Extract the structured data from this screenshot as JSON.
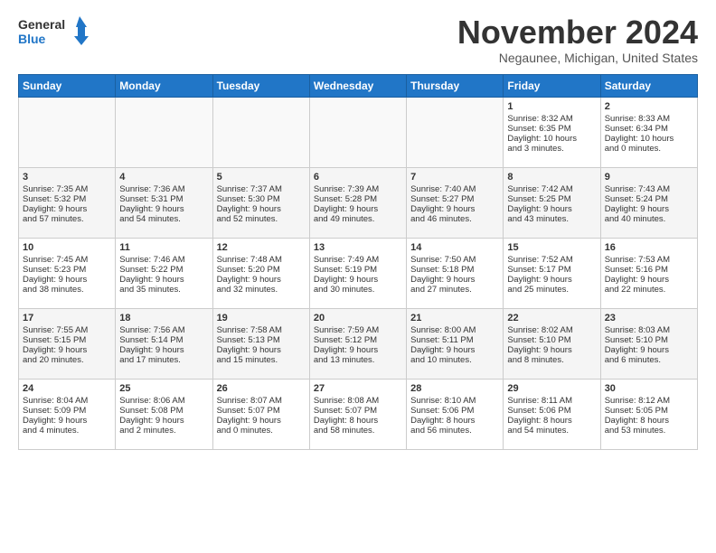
{
  "header": {
    "logo_line1": "General",
    "logo_line2": "Blue",
    "month_title": "November 2024",
    "location": "Negaunee, Michigan, United States"
  },
  "weekdays": [
    "Sunday",
    "Monday",
    "Tuesday",
    "Wednesday",
    "Thursday",
    "Friday",
    "Saturday"
  ],
  "weeks": [
    [
      {
        "day": "",
        "info": ""
      },
      {
        "day": "",
        "info": ""
      },
      {
        "day": "",
        "info": ""
      },
      {
        "day": "",
        "info": ""
      },
      {
        "day": "",
        "info": ""
      },
      {
        "day": "1",
        "info": "Sunrise: 8:32 AM\nSunset: 6:35 PM\nDaylight: 10 hours\nand 3 minutes."
      },
      {
        "day": "2",
        "info": "Sunrise: 8:33 AM\nSunset: 6:34 PM\nDaylight: 10 hours\nand 0 minutes."
      }
    ],
    [
      {
        "day": "3",
        "info": "Sunrise: 7:35 AM\nSunset: 5:32 PM\nDaylight: 9 hours\nand 57 minutes."
      },
      {
        "day": "4",
        "info": "Sunrise: 7:36 AM\nSunset: 5:31 PM\nDaylight: 9 hours\nand 54 minutes."
      },
      {
        "day": "5",
        "info": "Sunrise: 7:37 AM\nSunset: 5:30 PM\nDaylight: 9 hours\nand 52 minutes."
      },
      {
        "day": "6",
        "info": "Sunrise: 7:39 AM\nSunset: 5:28 PM\nDaylight: 9 hours\nand 49 minutes."
      },
      {
        "day": "7",
        "info": "Sunrise: 7:40 AM\nSunset: 5:27 PM\nDaylight: 9 hours\nand 46 minutes."
      },
      {
        "day": "8",
        "info": "Sunrise: 7:42 AM\nSunset: 5:25 PM\nDaylight: 9 hours\nand 43 minutes."
      },
      {
        "day": "9",
        "info": "Sunrise: 7:43 AM\nSunset: 5:24 PM\nDaylight: 9 hours\nand 40 minutes."
      }
    ],
    [
      {
        "day": "10",
        "info": "Sunrise: 7:45 AM\nSunset: 5:23 PM\nDaylight: 9 hours\nand 38 minutes."
      },
      {
        "day": "11",
        "info": "Sunrise: 7:46 AM\nSunset: 5:22 PM\nDaylight: 9 hours\nand 35 minutes."
      },
      {
        "day": "12",
        "info": "Sunrise: 7:48 AM\nSunset: 5:20 PM\nDaylight: 9 hours\nand 32 minutes."
      },
      {
        "day": "13",
        "info": "Sunrise: 7:49 AM\nSunset: 5:19 PM\nDaylight: 9 hours\nand 30 minutes."
      },
      {
        "day": "14",
        "info": "Sunrise: 7:50 AM\nSunset: 5:18 PM\nDaylight: 9 hours\nand 27 minutes."
      },
      {
        "day": "15",
        "info": "Sunrise: 7:52 AM\nSunset: 5:17 PM\nDaylight: 9 hours\nand 25 minutes."
      },
      {
        "day": "16",
        "info": "Sunrise: 7:53 AM\nSunset: 5:16 PM\nDaylight: 9 hours\nand 22 minutes."
      }
    ],
    [
      {
        "day": "17",
        "info": "Sunrise: 7:55 AM\nSunset: 5:15 PM\nDaylight: 9 hours\nand 20 minutes."
      },
      {
        "day": "18",
        "info": "Sunrise: 7:56 AM\nSunset: 5:14 PM\nDaylight: 9 hours\nand 17 minutes."
      },
      {
        "day": "19",
        "info": "Sunrise: 7:58 AM\nSunset: 5:13 PM\nDaylight: 9 hours\nand 15 minutes."
      },
      {
        "day": "20",
        "info": "Sunrise: 7:59 AM\nSunset: 5:12 PM\nDaylight: 9 hours\nand 13 minutes."
      },
      {
        "day": "21",
        "info": "Sunrise: 8:00 AM\nSunset: 5:11 PM\nDaylight: 9 hours\nand 10 minutes."
      },
      {
        "day": "22",
        "info": "Sunrise: 8:02 AM\nSunset: 5:10 PM\nDaylight: 9 hours\nand 8 minutes."
      },
      {
        "day": "23",
        "info": "Sunrise: 8:03 AM\nSunset: 5:10 PM\nDaylight: 9 hours\nand 6 minutes."
      }
    ],
    [
      {
        "day": "24",
        "info": "Sunrise: 8:04 AM\nSunset: 5:09 PM\nDaylight: 9 hours\nand 4 minutes."
      },
      {
        "day": "25",
        "info": "Sunrise: 8:06 AM\nSunset: 5:08 PM\nDaylight: 9 hours\nand 2 minutes."
      },
      {
        "day": "26",
        "info": "Sunrise: 8:07 AM\nSunset: 5:07 PM\nDaylight: 9 hours\nand 0 minutes."
      },
      {
        "day": "27",
        "info": "Sunrise: 8:08 AM\nSunset: 5:07 PM\nDaylight: 8 hours\nand 58 minutes."
      },
      {
        "day": "28",
        "info": "Sunrise: 8:10 AM\nSunset: 5:06 PM\nDaylight: 8 hours\nand 56 minutes."
      },
      {
        "day": "29",
        "info": "Sunrise: 8:11 AM\nSunset: 5:06 PM\nDaylight: 8 hours\nand 54 minutes."
      },
      {
        "day": "30",
        "info": "Sunrise: 8:12 AM\nSunset: 5:05 PM\nDaylight: 8 hours\nand 53 minutes."
      }
    ]
  ]
}
